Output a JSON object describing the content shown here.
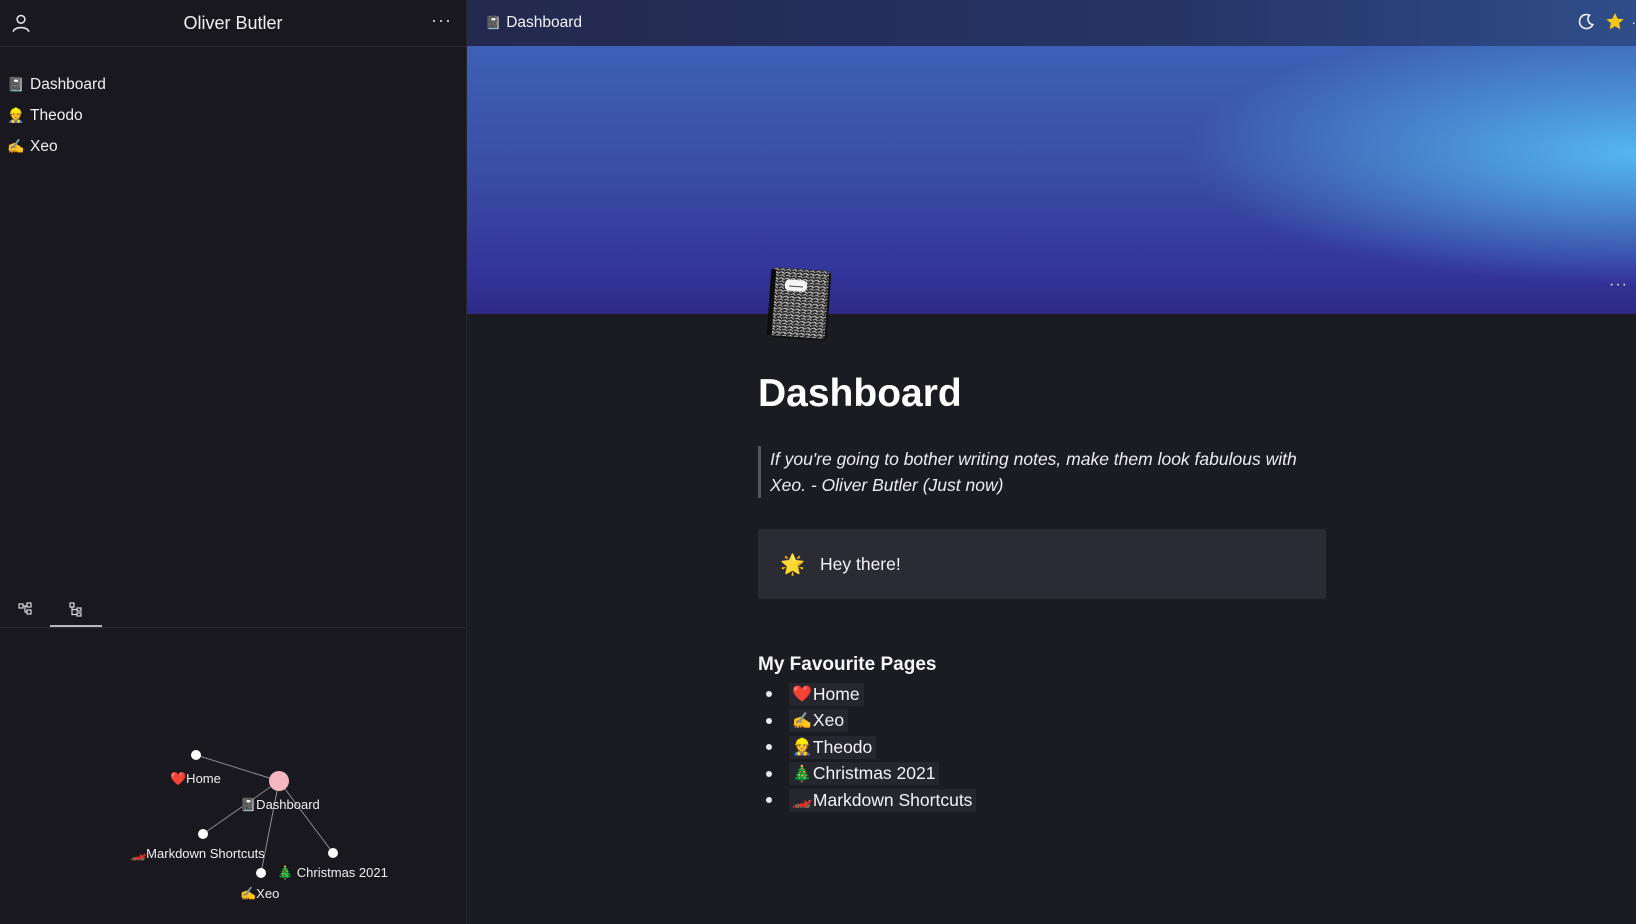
{
  "sidebar": {
    "user_name": "Oliver Butler",
    "more_label": "···",
    "items": [
      {
        "icon": "notebook-icon",
        "emoji": "📓",
        "label": "Dashboard"
      },
      {
        "icon": "person-icon",
        "emoji": "👷",
        "label": "Theodo"
      },
      {
        "icon": "writing-hand-icon",
        "emoji": "✍️",
        "label": "Xeo"
      }
    ],
    "tabs": [
      {
        "icon": "graph-view-icon",
        "active": false
      },
      {
        "icon": "tree-view-icon",
        "active": true
      }
    ],
    "graph": {
      "nodes": [
        {
          "id": "home",
          "label": "❤️Home"
        },
        {
          "id": "dashboard",
          "label": "📓Dashboard",
          "current": true
        },
        {
          "id": "markdown",
          "label": "🏎️Markdown Shortcuts"
        },
        {
          "id": "christmas",
          "label": "🎄 Christmas 2021"
        },
        {
          "id": "xeo",
          "label": "✍️Xeo"
        }
      ]
    }
  },
  "topbar": {
    "breadcrumb_emoji": "📓",
    "breadcrumb": "Dashboard",
    "icons": [
      "moon-icon",
      "star-icon",
      "more-icon"
    ],
    "star_color": "#f5c518"
  },
  "page": {
    "icon": "composition-notebook-icon",
    "cover_more": "···",
    "title": "Dashboard",
    "quote": "If you're going to bother writing notes, make them look fabulous with Xeo. - Oliver Butler (Just now)",
    "callout": {
      "emoji": "🌟",
      "text": "Hey there!"
    },
    "favourites_heading": "My Favourite Pages",
    "favourites": [
      {
        "emoji": "❤️",
        "label": "Home"
      },
      {
        "emoji": "✍️",
        "label": "Xeo"
      },
      {
        "emoji": "👷",
        "label": "Theodo"
      },
      {
        "emoji": "🎄",
        "label": "Christmas 2021"
      },
      {
        "emoji": "🏎️",
        "label": "Markdown Shortcuts"
      }
    ]
  },
  "colors": {
    "background": "#1b1b22",
    "sidebar": "#18181e",
    "callout": "#2b2b33",
    "graph_current_node": "#f4b6bf",
    "cover_accent": "#56bcf5"
  }
}
